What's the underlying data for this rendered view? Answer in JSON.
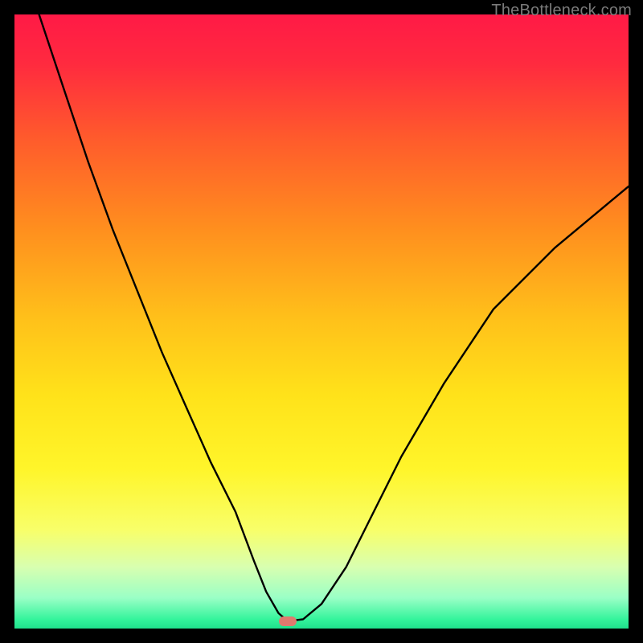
{
  "attribution": "TheBottleneck.com",
  "colors": {
    "frame": "#000000",
    "gradient_stops": [
      {
        "offset": 0.0,
        "color": "#ff1a46"
      },
      {
        "offset": 0.08,
        "color": "#ff2a3f"
      },
      {
        "offset": 0.2,
        "color": "#ff5a2c"
      },
      {
        "offset": 0.35,
        "color": "#ff8f1e"
      },
      {
        "offset": 0.5,
        "color": "#ffc21a"
      },
      {
        "offset": 0.62,
        "color": "#ffe21a"
      },
      {
        "offset": 0.74,
        "color": "#fff52a"
      },
      {
        "offset": 0.84,
        "color": "#f8ff6a"
      },
      {
        "offset": 0.9,
        "color": "#d8ffb0"
      },
      {
        "offset": 0.95,
        "color": "#9affc6"
      },
      {
        "offset": 0.985,
        "color": "#34f49c"
      },
      {
        "offset": 1.0,
        "color": "#1fe08c"
      }
    ],
    "curve": "#000000",
    "marker": "#e07a6e"
  },
  "marker": {
    "x_frac": 0.445,
    "y_frac": 0.988
  },
  "chart_data": {
    "type": "line",
    "title": "",
    "xlabel": "",
    "ylabel": "",
    "xlim": [
      0,
      100
    ],
    "ylim": [
      0,
      100
    ],
    "x": [
      4,
      8,
      12,
      16,
      20,
      24,
      28,
      32,
      36,
      39,
      41,
      43,
      44.5,
      47,
      50,
      54,
      58,
      63,
      70,
      78,
      88,
      100
    ],
    "values": [
      100,
      88,
      76,
      65,
      55,
      45,
      36,
      27,
      19,
      11,
      6,
      2.5,
      1.2,
      1.5,
      4,
      10,
      18,
      28,
      40,
      52,
      62,
      72
    ],
    "annotations": [
      {
        "kind": "marker",
        "x": 44.5,
        "y": 1.2,
        "color": "#e07a6e"
      }
    ],
    "notes": "V-shaped bottleneck curve; heatmap background runs red (top) → yellow → green (bottom)."
  }
}
